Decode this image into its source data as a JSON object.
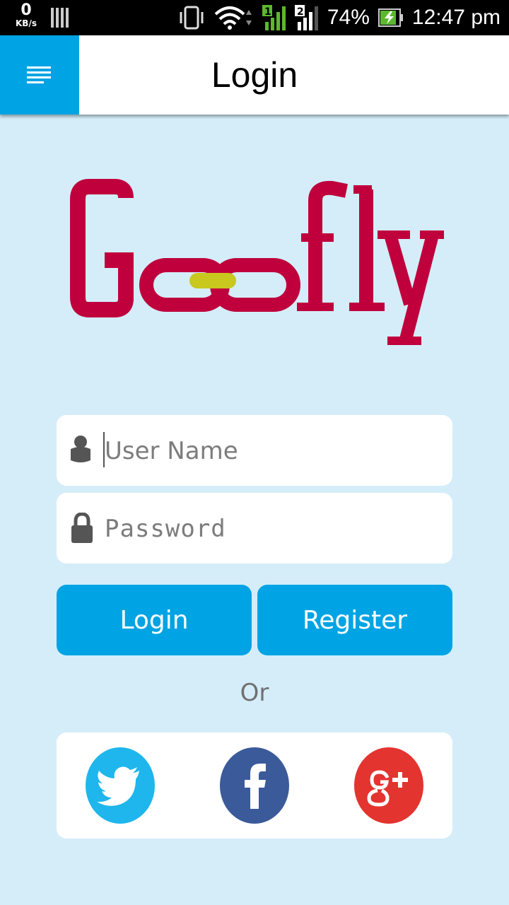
{
  "status_bar": {
    "net_speed": "0",
    "net_unit": "KB/s",
    "sim1": "1",
    "sim2": "2",
    "battery": "74%",
    "time": "12:47 pm"
  },
  "header": {
    "title": "Login",
    "menu_icon": "menu-icon",
    "accent": "#00a4e4"
  },
  "logo": {
    "text": "Goofly",
    "color": "#c0003c",
    "link_color": "#c8c81e"
  },
  "form": {
    "username_placeholder": "User Name",
    "username_value": "",
    "password_placeholder": "Password",
    "password_value": "",
    "login_label": "Login",
    "register_label": "Register",
    "or_label": "Or"
  },
  "social": {
    "items": [
      {
        "name": "twitter",
        "icon": "twitter-icon",
        "color": "#1eb6ec"
      },
      {
        "name": "facebook",
        "icon": "facebook-icon",
        "color": "#3b5a9a"
      },
      {
        "name": "google-plus",
        "icon": "google-plus-icon",
        "color": "#e3342f"
      }
    ]
  }
}
